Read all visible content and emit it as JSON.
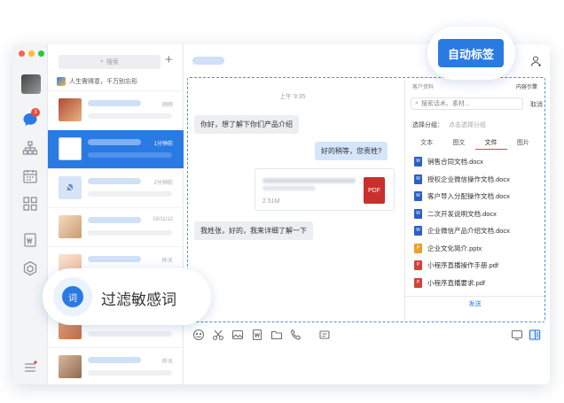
{
  "list": {
    "search_placeholder": "搜索",
    "plus": "+",
    "motto": "人生需得意，千万别忘形",
    "rows": [
      {
        "time": "刚刚",
        "color": "#b04a3a"
      },
      {
        "time": "1分钟前",
        "color": "#eef3fa"
      },
      {
        "time": "2分钟前",
        "color": "#dfe8f6"
      },
      {
        "time": "19/11/12",
        "color": "#e8c7a8"
      },
      {
        "time": "昨天",
        "color": "#f6dcc6"
      },
      {
        "time": "",
        "color": "#e7a77d"
      },
      {
        "time": "昨天",
        "color": "#c59c7e"
      }
    ]
  },
  "chat": {
    "time": "上午 9:35",
    "messages": [
      {
        "text": "你好，想了解下你们产品介绍"
      },
      {
        "text": "好的稍等，您贵姓?"
      },
      {
        "text": "我姓张，好的，我来详细了解一下"
      }
    ],
    "file_card": {
      "size": "2.51M",
      "badge": "PDF"
    }
  },
  "side": {
    "tabs": [
      "客户资料",
      "内容引擎"
    ],
    "search_placeholder": "搜索话术、素材...",
    "cancel": "取消",
    "group_label": "选择分组：",
    "group_hint": "点击选择分组",
    "types": [
      "文本",
      "图文",
      "文件",
      "图片"
    ],
    "files": [
      {
        "name": "销售合同文档.docx",
        "color": "#2b5fc7",
        "icon": "W"
      },
      {
        "name": "授权企业微信操作文档.docx",
        "color": "#2b5fc7",
        "icon": "W"
      },
      {
        "name": "客户导入分配操作文档.docx",
        "color": "#2b5fc7",
        "icon": "W"
      },
      {
        "name": "二次开发说明文档.docx",
        "color": "#2b5fc7",
        "icon": "W"
      },
      {
        "name": "企业微信产品介绍文档.docx",
        "color": "#2b5fc7",
        "icon": "W"
      },
      {
        "name": "企业文化简介.pptx",
        "color": "#e9a02b",
        "icon": "P"
      },
      {
        "name": "小程序直播操作手册.pdf",
        "color": "#d2413a",
        "icon": "P"
      },
      {
        "name": "小程序直播要求.pdf",
        "color": "#d2413a",
        "icon": "P"
      }
    ],
    "send": "发送"
  },
  "overlay": {
    "auto_tag": "自动标签",
    "filter_label": "过滤敏感词",
    "filter_icon": "词"
  },
  "rail": {
    "badge": "3"
  }
}
